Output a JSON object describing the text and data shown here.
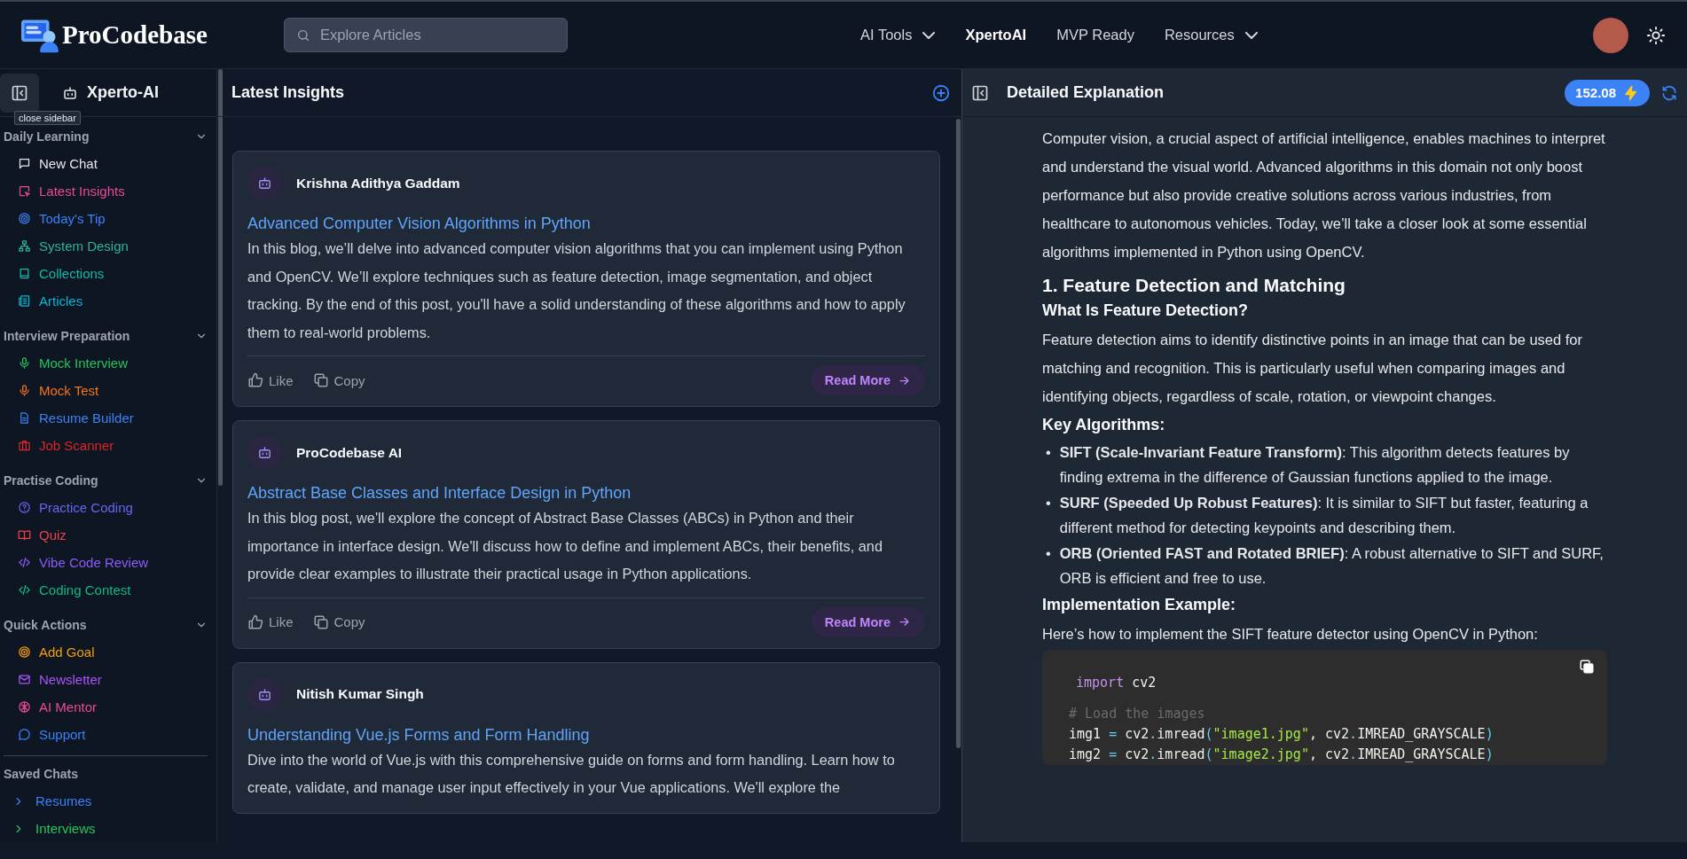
{
  "header": {
    "logo": "ProCodebase",
    "search": {
      "placeholder": "Explore Articles"
    },
    "nav": [
      {
        "label": "AI Tools",
        "dropdown": true,
        "selected": false
      },
      {
        "label": "XpertoAI",
        "dropdown": false,
        "selected": true
      },
      {
        "label": "MVP Ready",
        "dropdown": false,
        "selected": false
      },
      {
        "label": "Resources",
        "dropdown": true,
        "selected": false
      }
    ]
  },
  "sidebar": {
    "title": "Xperto-AI",
    "tooltip": "close sidebar",
    "sections": [
      {
        "title": "Daily Learning",
        "expanded": true,
        "items": [
          {
            "label": "New Chat",
            "color": "#e5e7eb"
          },
          {
            "label": "Latest Insights",
            "color": "#ec4899"
          },
          {
            "label": "Today's Tip",
            "color": "#3b82f6"
          },
          {
            "label": "System Design",
            "color": "#2bb59a"
          },
          {
            "label": "Collections",
            "color": "#14b8a6"
          },
          {
            "label": "Articles",
            "color": "#06b6d4"
          }
        ]
      },
      {
        "title": "Interview Preparation",
        "expanded": true,
        "items": [
          {
            "label": "Mock Interview",
            "color": "#22c55e"
          },
          {
            "label": "Mock Test",
            "color": "#f97316"
          },
          {
            "label": "Resume Builder",
            "color": "#3b82f6"
          },
          {
            "label": "Job Scanner",
            "color": "#dc2626"
          }
        ]
      },
      {
        "title": "Practise Coding",
        "expanded": true,
        "items": [
          {
            "label": "Practice Coding",
            "color": "#6366f1"
          },
          {
            "label": "Quiz",
            "color": "#ef4444"
          },
          {
            "label": "Vibe Code Review",
            "color": "#8b5cf6"
          },
          {
            "label": "Coding Contest",
            "color": "#10b981"
          }
        ]
      },
      {
        "title": "Quick Actions",
        "expanded": true,
        "items": [
          {
            "label": "Add Goal",
            "color": "#f59e0b"
          },
          {
            "label": "Newsletter",
            "color": "#a855f7"
          },
          {
            "label": "AI Mentor",
            "color": "#ec4899"
          },
          {
            "label": "Support",
            "color": "#3b82f6"
          }
        ]
      }
    ],
    "saved_chats": {
      "title": "Saved Chats",
      "items": [
        {
          "label": "Resumes",
          "expanded": false,
          "color": "#3b82f6"
        },
        {
          "label": "Interviews",
          "expanded": false,
          "color": "#22c55e"
        }
      ]
    }
  },
  "insights": {
    "title": "Latest Insights",
    "cards": [
      {
        "author": "Krishna Adithya Gaddam",
        "title": "Advanced Computer Vision Algorithms in Python",
        "description": "In this blog, we’ll delve into advanced computer vision algorithms that you can implement using Python and OpenCV. We’ll explore techniques such as feature detection, image segmentation, and object tracking. By the end of this post, you'll have a solid understanding of these algorithms and how to apply them to real-world problems.",
        "actions": [
          {
            "kind": "like",
            "label": "Like"
          },
          {
            "kind": "copy",
            "label": "Copy"
          }
        ],
        "read_more": "Read More"
      },
      {
        "author": "ProCodebase AI",
        "title": "Abstract Base Classes and Interface Design in Python",
        "description": "In this blog post, we'll explore the concept of Abstract Base Classes (ABCs) in Python and their importance in interface design. We'll discuss how to define and implement ABCs, their benefits, and provide clear examples to illustrate their practical usage in Python applications.",
        "actions": [
          {
            "kind": "like",
            "label": "Like"
          },
          {
            "kind": "copy",
            "label": "Copy"
          }
        ],
        "read_more": "Read More"
      },
      {
        "author": "Nitish Kumar Singh",
        "title": "Understanding Vue.js Forms and Form Handling",
        "description": "Dive into the world of Vue.js with this comprehensive guide on forms and form handling. Learn how to create, validate, and manage user input effectively in your Vue applications. We'll explore the"
      }
    ]
  },
  "detail": {
    "title": "Detailed Explanation",
    "credits": "152.08",
    "blocks": [
      {
        "kind": "p",
        "text": "Computer vision, a crucial aspect of artificial intelligence, enables machines to interpret and understand the visual world. Advanced algorithms in this domain not only boost performance but also provide creative solutions across various industries, from healthcare to autonomous vehicles. Today, we’ll take a closer look at some essential algorithms implemented in Python using OpenCV."
      },
      {
        "kind": "h2",
        "text": "1. Feature Detection and Matching"
      },
      {
        "kind": "h3",
        "text": "What Is Feature Detection?"
      },
      {
        "kind": "p",
        "text": "Feature detection aims to identify distinctive points in an image that can be used for matching and recognition. This is particularly useful when comparing images and identifying objects, regardless of scale, rotation, or viewpoint changes."
      },
      {
        "kind": "h3",
        "text": "Key Algorithms:"
      },
      {
        "kind": "list",
        "items": [
          {
            "marker": "•",
            "text": "**SIFT (Scale-Invariant Feature Transform)**: This algorithm detects features by finding extrema in the difference of Gaussian functions applied to the image."
          },
          {
            "marker": "•",
            "text": "**SURF (Speeded Up Robust Features)**: It is similar to SIFT but faster, featuring a different method for detecting keypoints and describing them."
          },
          {
            "marker": "•",
            "text": "**ORB (Oriented FAST and Rotated BRIEF)**: A robust alternative to SIFT and SURF, ORB is efficient and free to use."
          }
        ]
      },
      {
        "kind": "h3",
        "text": "Implementation Example:"
      },
      {
        "kind": "p",
        "text": "Here’s how to implement the SIFT feature detector using OpenCV in Python:"
      },
      {
        "kind": "code",
        "groups": [
          [
            [
              {
                "kind": "keyword",
                "t": "import"
              },
              {
                "kind": "plain",
                "t": " cv2"
              }
            ]
          ],
          [
            [
              {
                "kind": "comment",
                "t": "# Load the images"
              }
            ],
            [
              {
                "kind": "plain",
                "t": "img1"
              },
              {
                "kind": "op",
                "t": " = "
              },
              {
                "kind": "plain",
                "t": "cv2"
              },
              {
                "kind": "op",
                "t": "."
              },
              {
                "kind": "plain",
                "t": "imread"
              },
              {
                "kind": "op",
                "t": "("
              },
              {
                "kind": "string",
                "t": "\"image1.jpg\""
              },
              {
                "kind": "plain",
                "t": ", cv2"
              },
              {
                "kind": "op",
                "t": "."
              },
              {
                "kind": "plain",
                "t": "IMREAD_GRAYSCALE"
              },
              {
                "kind": "op",
                "t": ")"
              }
            ],
            [
              {
                "kind": "plain",
                "t": "img2"
              },
              {
                "kind": "op",
                "t": " = "
              },
              {
                "kind": "plain",
                "t": "cv2"
              },
              {
                "kind": "op",
                "t": "."
              },
              {
                "kind": "plain",
                "t": "imread"
              },
              {
                "kind": "op",
                "t": "("
              },
              {
                "kind": "string",
                "t": "\"image2.jpg\""
              },
              {
                "kind": "plain",
                "t": ", cv2"
              },
              {
                "kind": "op",
                "t": "."
              },
              {
                "kind": "plain",
                "t": "IMREAD_GRAYSCALE"
              },
              {
                "kind": "op",
                "t": ")"
              }
            ]
          ]
        ]
      }
    ]
  }
}
